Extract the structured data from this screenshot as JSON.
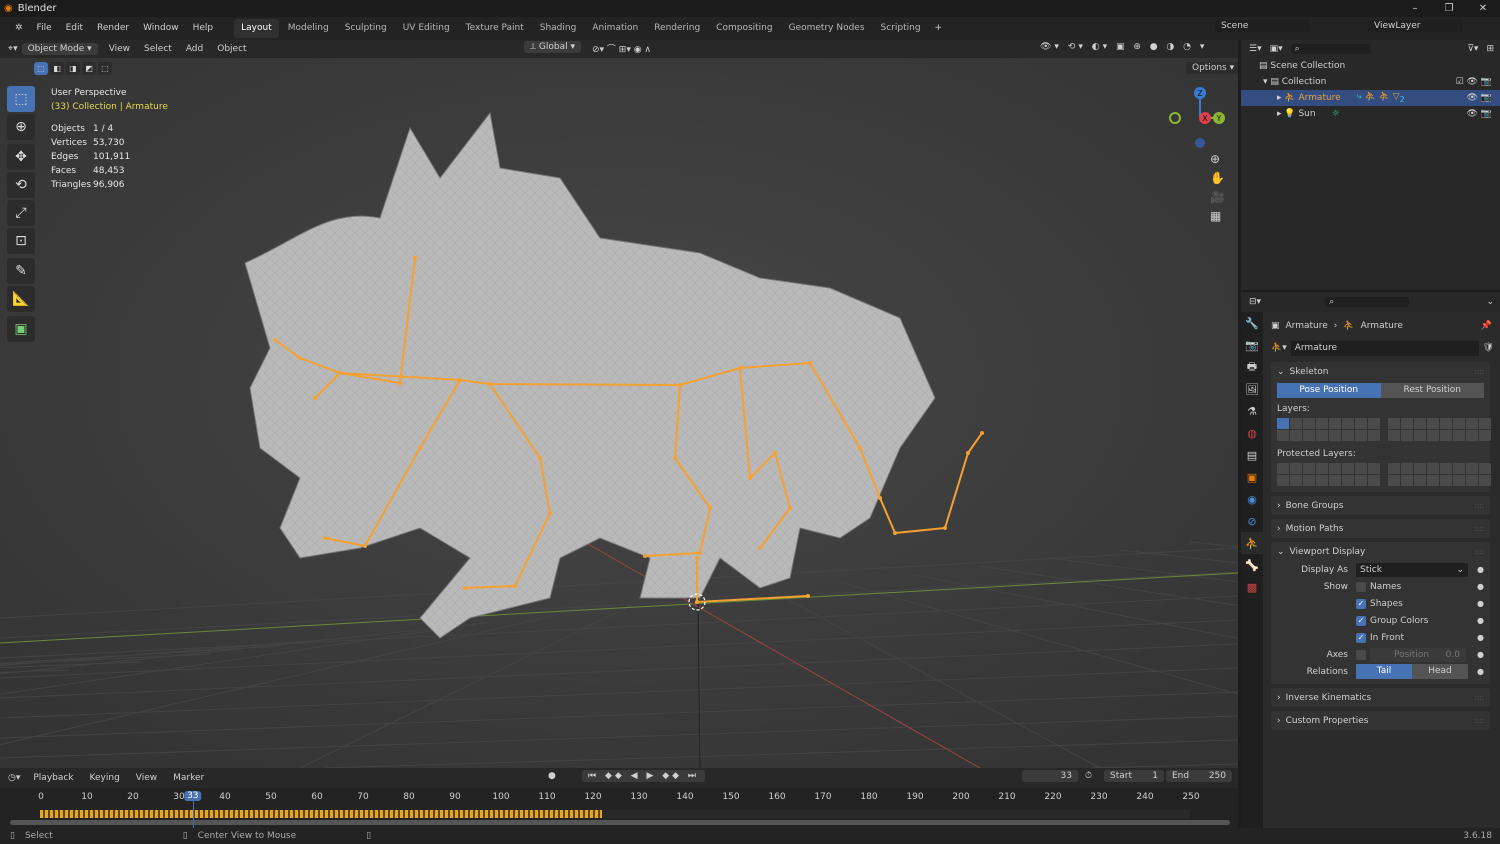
{
  "window": {
    "title": "Blender",
    "controls": [
      "–",
      "❐",
      "✕"
    ]
  },
  "menu": {
    "items": [
      "File",
      "Edit",
      "Render",
      "Window",
      "Help"
    ],
    "workspaces": [
      "Layout",
      "Modeling",
      "Sculpting",
      "UV Editing",
      "Texture Paint",
      "Shading",
      "Animation",
      "Rendering",
      "Compositing",
      "Geometry Nodes",
      "Scripting"
    ],
    "active_workspace": "Layout",
    "add": "+",
    "scene": "Scene",
    "view_layer": "ViewLayer"
  },
  "viewport_header": {
    "mode": "Object Mode",
    "menus": [
      "View",
      "Select",
      "Add",
      "Object"
    ],
    "orientation": "Global",
    "options": "Options"
  },
  "overlay": {
    "perspective": "User Perspective",
    "context": "(33) Collection | Armature",
    "stats": [
      {
        "label": "Objects",
        "value": "1 / 4"
      },
      {
        "label": "Vertices",
        "value": "53,730"
      },
      {
        "label": "Edges",
        "value": "101,911"
      },
      {
        "label": "Faces",
        "value": "48,453"
      },
      {
        "label": "Triangles",
        "value": "96,906"
      }
    ]
  },
  "gizmo": {
    "x": "X",
    "y": "Y",
    "z": "Z"
  },
  "colors": {
    "accent": "#4772b3",
    "bone": "#f5a030",
    "selected_text": "#e6a23c",
    "stats_highlight": "#e6d94e"
  },
  "outliner": {
    "rows": [
      {
        "name": "Scene Collection"
      },
      {
        "name": "Collection"
      },
      {
        "name": "Armature",
        "badge": "2"
      },
      {
        "name": "Sun"
      }
    ]
  },
  "properties": {
    "breadcrumb": [
      "Armature",
      "Armature"
    ],
    "data_name": "Armature",
    "skeleton": {
      "title": "Skeleton",
      "pose": "Pose Position",
      "rest": "Rest Position",
      "layers": "Layers:",
      "protected": "Protected Layers:"
    },
    "collapsed": [
      "Bone Groups",
      "Motion Paths"
    ],
    "viewport_display": {
      "title": "Viewport Display",
      "display_as_label": "Display As",
      "display_as": "Stick",
      "show_label": "Show",
      "checks": [
        {
          "label": "Names",
          "checked": false
        },
        {
          "label": "Shapes",
          "checked": true
        },
        {
          "label": "Group Colors",
          "checked": true
        },
        {
          "label": "In Front",
          "checked": true
        }
      ],
      "axes_label": "Axes",
      "axes_pos_label": "Position",
      "axes_pos": "0.0",
      "relations_label": "Relations",
      "tail": "Tail",
      "head": "Head"
    },
    "collapsed2": [
      "Inverse Kinematics",
      "Custom Properties"
    ]
  },
  "timeline": {
    "menus": [
      "Playback",
      "Keying",
      "View",
      "Marker"
    ],
    "current_frame": "33",
    "start_label": "Start",
    "start": "1",
    "end_label": "End",
    "end": "250",
    "ticks": [
      "0",
      "10",
      "20",
      "30",
      "40",
      "50",
      "60",
      "70",
      "80",
      "90",
      "100",
      "110",
      "120",
      "130",
      "140",
      "150",
      "160",
      "170",
      "180",
      "190",
      "200",
      "210",
      "220",
      "230",
      "240",
      "250"
    ]
  },
  "status": {
    "left": "Select",
    "middle": "Center View to Mouse",
    "version": "3.6.18"
  }
}
